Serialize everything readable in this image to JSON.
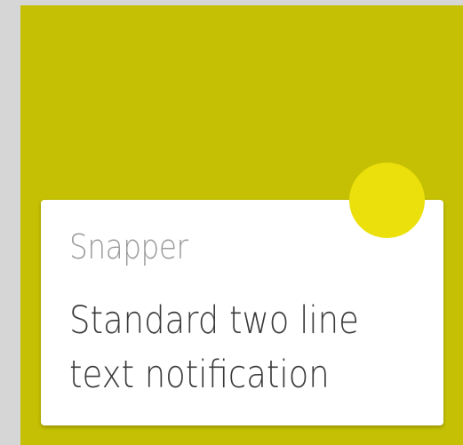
{
  "notification": {
    "app_name": "Snapper",
    "body_lines": [
      "Standard two line",
      "text notification"
    ]
  },
  "colors": {
    "page_background": "#d6d6d6",
    "screen_background": "#c5c003",
    "card_background": "#ffffff",
    "app_icon": "#ebe00c",
    "app_name_text": "#9a9a9a",
    "body_text": "#3a3a3a"
  },
  "icons": {
    "app_icon": "app-icon"
  }
}
